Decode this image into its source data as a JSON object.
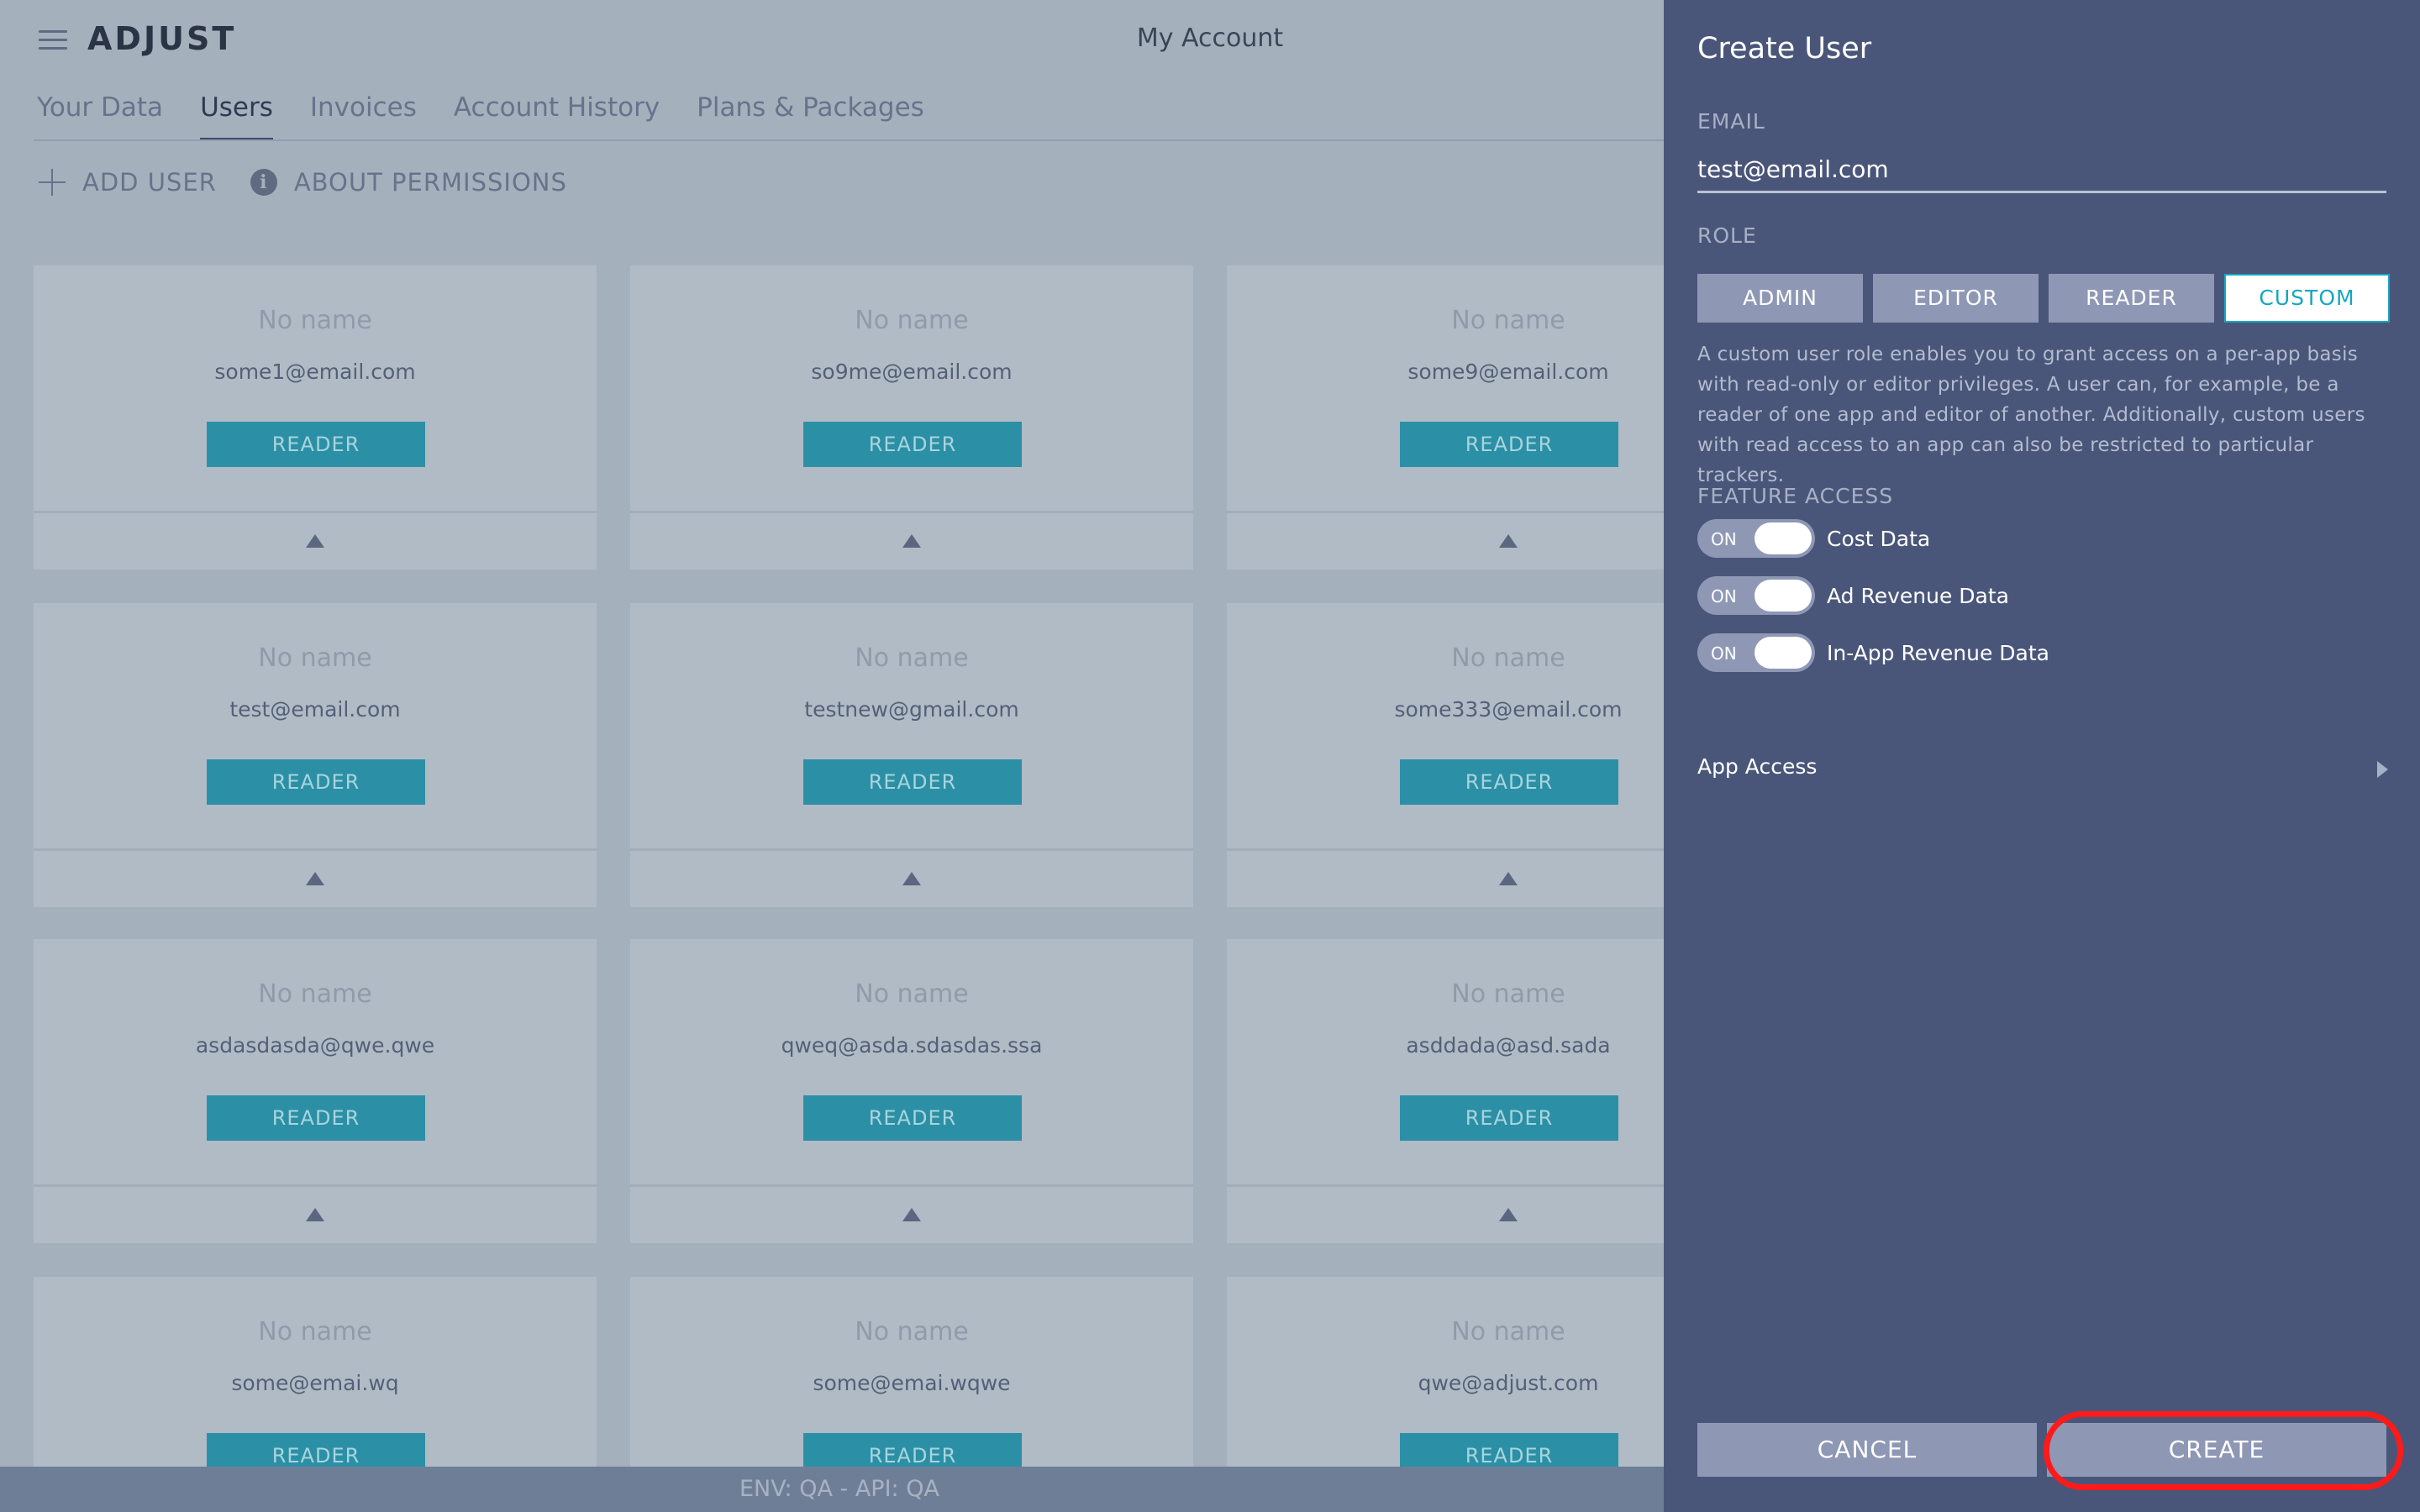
{
  "header": {
    "logo": "ADJUST",
    "title": "My Account"
  },
  "tabs": [
    {
      "label": "Your Data"
    },
    {
      "label": "Users"
    },
    {
      "label": "Invoices"
    },
    {
      "label": "Account History"
    },
    {
      "label": "Plans & Packages"
    }
  ],
  "actions": {
    "add_user": "ADD USER",
    "about_permissions": "ABOUT PERMISSIONS",
    "info_glyph": "i"
  },
  "users": [
    {
      "name": "No name",
      "email": "some1@email.com",
      "role": "READER"
    },
    {
      "name": "No name",
      "email": "so9me@email.com",
      "role": "READER"
    },
    {
      "name": "No name",
      "email": "some9@email.com",
      "role": "READER"
    },
    {
      "name": "No name",
      "email": "test@email.com",
      "role": "READER"
    },
    {
      "name": "No name",
      "email": "testnew@gmail.com",
      "role": "READER"
    },
    {
      "name": "No name",
      "email": "some333@email.com",
      "role": "READER"
    },
    {
      "name": "No name",
      "email": "asdasdasda@qwe.qwe",
      "role": "READER"
    },
    {
      "name": "No name",
      "email": "qweq@asda.sdasdas.ssa",
      "role": "READER"
    },
    {
      "name": "No name",
      "email": "asddada@asd.sada",
      "role": "READER"
    },
    {
      "name": "No name",
      "email": "some@emai.wq",
      "role": "READER"
    },
    {
      "name": "No name",
      "email": "some@emai.wqwe",
      "role": "READER"
    },
    {
      "name": "No name",
      "email": "qwe@adjust.com",
      "role": "READER"
    }
  ],
  "footer": {
    "env": "ENV: QA - API: QA"
  },
  "panel": {
    "title": "Create User",
    "email_label": "EMAIL",
    "email_value": "test@email.com",
    "role_label": "ROLE",
    "roles": [
      "ADMIN",
      "EDITOR",
      "READER",
      "CUSTOM"
    ],
    "selected_role": "CUSTOM",
    "role_description": "A custom user role enables you to grant access on a per-app basis with read-only or editor privileges. A user can, for example, be a reader of one app and editor of another. Additionally, custom users with read access to an app can also be restricted to particular trackers.",
    "feature_access_label": "FEATURE ACCESS",
    "features": [
      {
        "state": "ON",
        "label": "Cost Data"
      },
      {
        "state": "ON",
        "label": "Ad Revenue Data"
      },
      {
        "state": "ON",
        "label": "In-App Revenue Data"
      }
    ],
    "app_access": "App Access",
    "cancel": "CANCEL",
    "create": "CREATE"
  },
  "colors": {
    "panel_bg": "#4a5679",
    "accent": "#16a6c2",
    "reader_button": "#2b90a5",
    "highlight": "#ff1a1a"
  }
}
